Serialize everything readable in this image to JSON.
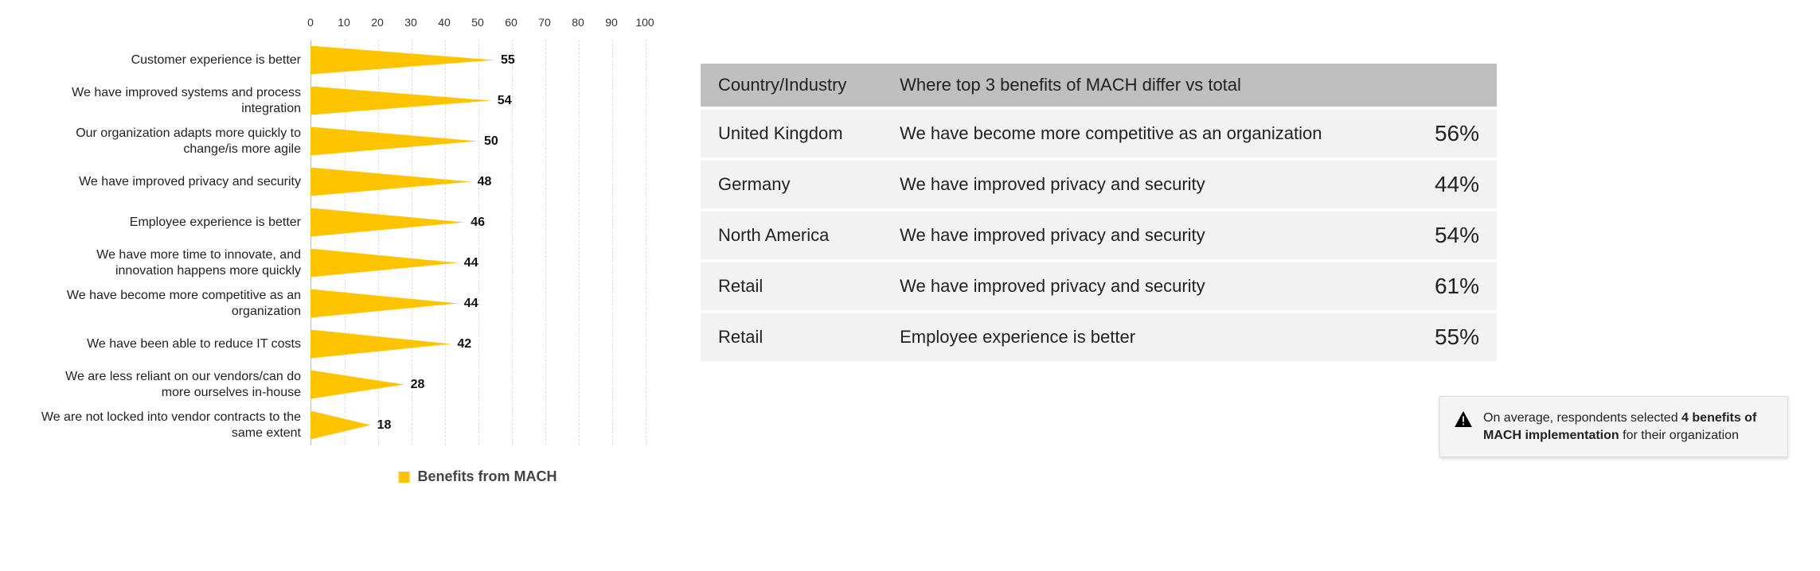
{
  "chart_data": {
    "type": "bar",
    "orientation": "horizontal",
    "title": "",
    "xlabel": "",
    "ylabel": "",
    "xlim": [
      0,
      100
    ],
    "x_ticks": [
      0,
      10,
      20,
      30,
      40,
      50,
      60,
      70,
      80,
      90,
      100
    ],
    "legend": "Benefits from MACH",
    "bar_color": "#ffc400",
    "categories": [
      "Customer experience is better",
      "We have improved systems and process integration",
      "Our organization adapts more quickly to change/is more agile",
      "We have improved privacy and security",
      "Employee experience is better",
      "We have more time to innovate, and innovation happens more quickly",
      "We have become more competitive as an organization",
      "We have been able to reduce IT costs",
      "We are less reliant on our vendors/can do more ourselves in-house",
      "We are not locked into vendor contracts to the same extent"
    ],
    "values": [
      55,
      54,
      50,
      48,
      46,
      44,
      44,
      42,
      28,
      18
    ]
  },
  "table": {
    "headers": [
      "Country/Industry",
      "Where top 3 benefits of MACH differ vs total"
    ],
    "rows": [
      {
        "segment": "United Kingdom",
        "benefit": "We have become more competitive as an organization",
        "pct": "56%"
      },
      {
        "segment": "Germany",
        "benefit": "We have improved privacy and security",
        "pct": "44%"
      },
      {
        "segment": "North America",
        "benefit": "We have improved privacy and security",
        "pct": "54%"
      },
      {
        "segment": "Retail",
        "benefit": "We have improved privacy and security",
        "pct": "61%"
      },
      {
        "segment": "Retail",
        "benefit": "Employee experience is better",
        "pct": "55%"
      }
    ]
  },
  "note": {
    "prefix": "On average, respondents selected ",
    "bold": "4 benefits of MACH implementation",
    "suffix": " for their organization"
  }
}
